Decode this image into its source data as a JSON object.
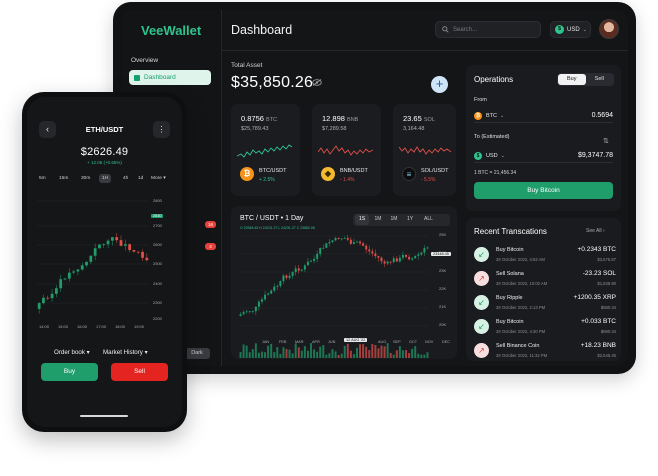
{
  "tablet": {
    "brand": "VeeWallet",
    "sidebar": {
      "section": "Overview",
      "active_item": "Dashboard",
      "badges": [
        "16",
        "4"
      ],
      "theme_chip": "Dark"
    },
    "header": {
      "title": "Dashboard",
      "search_placeholder": "Search...",
      "currency": "USD",
      "currency_symbol": "$"
    },
    "total_asset": {
      "label": "Total Asset",
      "value": "$35,850.26",
      "add_symbol": "+"
    },
    "coins": [
      {
        "amount": "0.8756",
        "ticker": "BTC",
        "usd": "$25,789.43",
        "pair": "BTC/USDT",
        "change": "+ 2.5%",
        "icon": "₿",
        "icon_bg": "#f7931a",
        "trend": "up"
      },
      {
        "amount": "12.898",
        "ticker": "BNB",
        "usd": "$7,289.58",
        "pair": "BNB/USDT",
        "change": "- 1.4%",
        "icon": "◆",
        "icon_bg": "#f3ba2f",
        "trend": "down"
      },
      {
        "amount": "23.65",
        "ticker": "SOL",
        "usd": "3,164.48",
        "pair": "SOL/USDT",
        "change": "- 5.5%",
        "icon": "≡",
        "icon_bg": "#1b1b1f",
        "trend": "down"
      }
    ],
    "chart": {
      "title": "BTC / USDT",
      "interval_label": "1 Day",
      "legend": "O 23948.45 H 24231.27 L 24231.27 C 23882.06",
      "timeframes": [
        "1S",
        "1M",
        "1M",
        "1Y",
        "ALL"
      ],
      "active_timeframe": 0,
      "price_axis": [
        "25K",
        "24K",
        "23K",
        "22K",
        "21K",
        "20K",
        "19K",
        "18K"
      ],
      "month_axis": [
        "JAN",
        "FEB",
        "MAR",
        "APR",
        "JUN",
        "",
        "AUG",
        "SEP",
        "OCT",
        "NOV",
        "DEC"
      ],
      "price_tag": "23448.45",
      "date_tag": "12 AUG '22"
    },
    "operations": {
      "title": "Operations",
      "tabs": [
        "Buy",
        "Sell"
      ],
      "active_tab": 0,
      "from_label": "From",
      "from_currency": "BTC",
      "from_value": "0.5694",
      "to_label": "To (Estimated)",
      "to_currency": "USD",
      "to_value": "$9,3747.78",
      "rate": "1 BTC = 21,456.34",
      "button": "Buy Bitcoin"
    },
    "recent": {
      "title": "Recent Transcations",
      "see_all": "See All",
      "items": [
        {
          "name": "Buy Bitcoin",
          "date": "28 October 2022, 4:52 AM",
          "amount": "+0.2343 BTC",
          "usd": "$3,675.87",
          "type": "buy"
        },
        {
          "name": "Sell Solana",
          "date": "28 October 2022, 10:02 AM",
          "amount": "-23.23 SOL",
          "usd": "$1,638.80",
          "type": "sell"
        },
        {
          "name": "Buy Ripple",
          "date": "28 October 2022, 2:13 PM",
          "amount": "+1200.35 XRP",
          "usd": "$580.34",
          "type": "buy"
        },
        {
          "name": "Buy Bitcoin",
          "date": "28 October 2022, 4:30 PM",
          "amount": "+0.033 BTC",
          "usd": "$690.34",
          "type": "buy"
        },
        {
          "name": "Sell Binance Coin",
          "date": "28 October 2022, 11:32 PM",
          "amount": "+18.23 BNB",
          "usd": "$2,545.45",
          "type": "sell"
        }
      ]
    }
  },
  "phone": {
    "pair": "ETH/USDT",
    "price": "$2626.49",
    "change": "+ 12.06 (+0.65%)",
    "timeframes": [
      "5m",
      "15m",
      "30m",
      "1H",
      "4h",
      "1d",
      "More ▾"
    ],
    "active_timeframe": 3,
    "price_axis": [
      "2800",
      "2700",
      "2600",
      "2500",
      "2400",
      "2300",
      "2200"
    ],
    "price_tag": "2630",
    "time_axis": [
      "14:00",
      "15:00",
      "16:00",
      "17:00",
      "18:00",
      "19:00"
    ],
    "tabs": [
      "Order book ▾",
      "Market History ▾"
    ],
    "buy": "Buy",
    "sell": "Sell"
  },
  "colors": {
    "accent": "#2fc38d",
    "up": "#1f9e6c",
    "down": "#e0504a",
    "bg": "#141517",
    "card": "#1a1b1e"
  },
  "icons": {
    "search": "search-icon",
    "eye_off": "eye-off-icon",
    "back": "chevron-left-icon",
    "menu": "more-vertical-icon",
    "swap": "swap-icon"
  }
}
